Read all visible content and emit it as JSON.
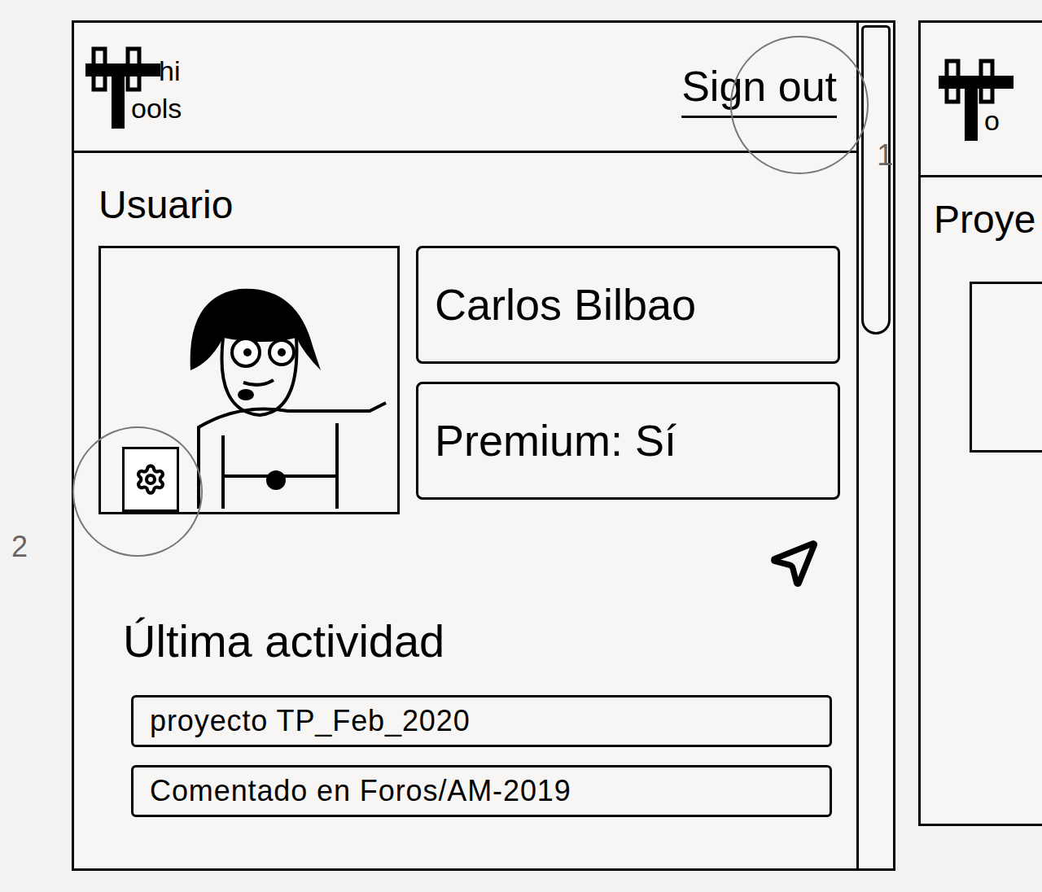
{
  "header": {
    "logo": {
      "line1": "hi",
      "line2": "ools"
    },
    "sign_out": "Sign out"
  },
  "annotations": [
    "1",
    "2"
  ],
  "user": {
    "section_title": "Usuario",
    "name": "Carlos Bilbao",
    "premium": "Premium: Sí"
  },
  "activity": {
    "title": "Última actividad",
    "items": [
      "proyecto TP_Feb_2020",
      "Comentado en Foros/AM-2019"
    ]
  },
  "second_window": {
    "logo_partial": "o",
    "section_title_partial": "Proye"
  }
}
